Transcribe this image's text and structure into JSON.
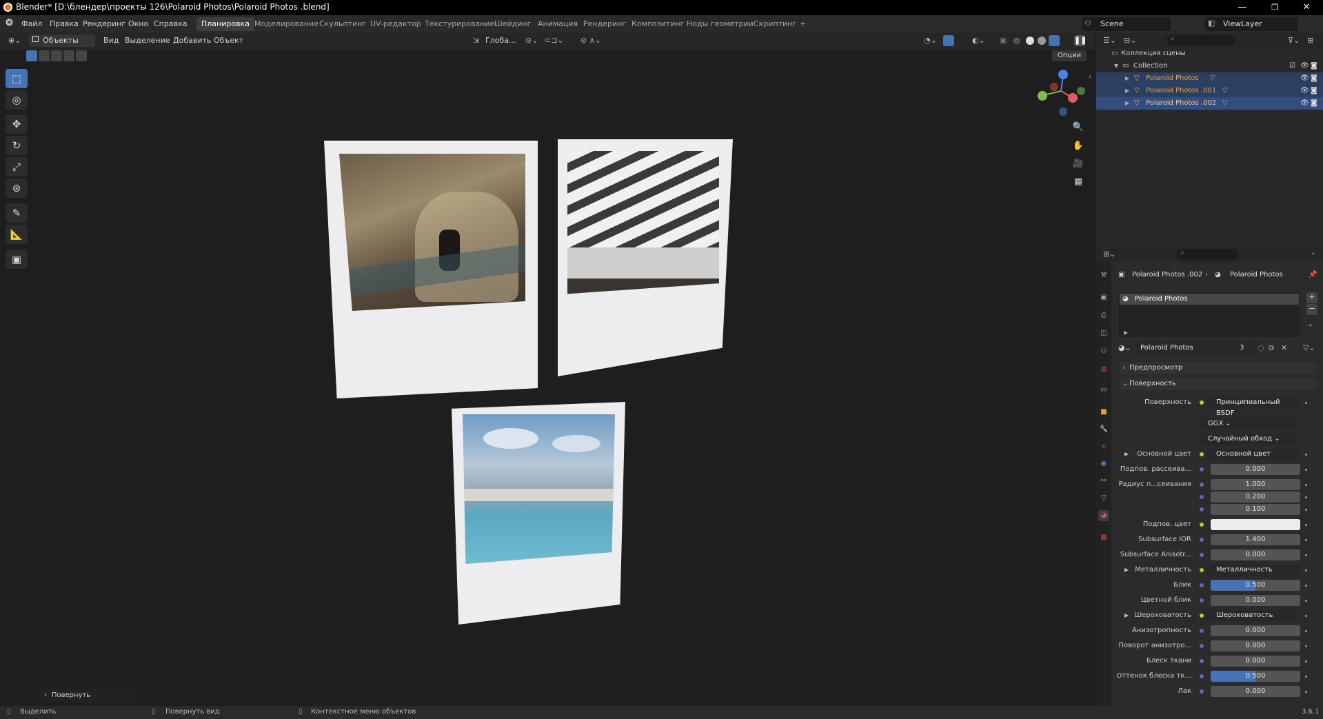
{
  "window": {
    "title": "Blender* [D:\\блендер\\проекты 126\\Polaroid Photos\\Polaroid Photos .blend]",
    "minimize": "—",
    "maximize": "❐",
    "close": "✕"
  },
  "menu": [
    "Файл",
    "Правка",
    "Рендеринг",
    "Окно",
    "Справка"
  ],
  "workspaces": [
    "Планировка",
    "Моделирование",
    "Скульптинг",
    "UV-редактор",
    "Текстурирование",
    "Шейдинг",
    "Анимация",
    "Рендеринг",
    "Композитинг",
    "Ноды геометрии",
    "Скриптинг",
    "+"
  ],
  "scene": {
    "name": "Scene",
    "view_layer": "ViewLayer"
  },
  "viewport_header": {
    "mode": "Объекты",
    "menus": [
      "Вид",
      "Выделение",
      "Добавить",
      "Объект"
    ],
    "transform": "Глоба...",
    "options": "Опции"
  },
  "redo_panel": "Повернуть",
  "outliner": {
    "root": "Коллекция сцены",
    "collection": "Collection",
    "objects": [
      "Polaroid Photos",
      "Polaroid Photos .001",
      "Polaroid Photos .002"
    ]
  },
  "properties": {
    "breadcrumb_object": "Polaroid Photos .002",
    "breadcrumb_material": "Polaroid Photos",
    "slot": "Polaroid Photos",
    "material_name": "Polaroid Photos",
    "users": "3",
    "sections": {
      "preview": "Предпросмотр",
      "surface": "Поверхность"
    },
    "rows": [
      {
        "label": "Поверхность",
        "value": "Принципиальный BSDF",
        "type": "link"
      },
      {
        "label": "",
        "value": "GGX ⌄",
        "type": "dropdown"
      },
      {
        "label": "",
        "value": "Случайный обход ⌄",
        "type": "dropdown"
      },
      {
        "label": "Основной цвет",
        "value": "Основной цвет",
        "type": "link"
      },
      {
        "label": "Подпов. рассеива...",
        "value": "0.000",
        "type": "num"
      },
      {
        "label": "Радиус п...сеивания",
        "value": "1.000",
        "type": "num"
      },
      {
        "label": "",
        "value": "0.200",
        "type": "num"
      },
      {
        "label": "",
        "value": "0.100",
        "type": "num"
      },
      {
        "label": "Подпов. цвет",
        "value": "",
        "type": "color"
      },
      {
        "label": "Subsurface IOR",
        "value": "1.400",
        "type": "num"
      },
      {
        "label": "Subsurface Anisotr...",
        "value": "0.000",
        "type": "num"
      },
      {
        "label": "Металличность",
        "value": "Металличность",
        "type": "link"
      },
      {
        "label": "Блик",
        "value": "0.500",
        "type": "slider"
      },
      {
        "label": "Цветной блик",
        "value": "0.000",
        "type": "num"
      },
      {
        "label": "Шероховатость",
        "value": "Шероховатость",
        "type": "link"
      },
      {
        "label": "Анизотропность",
        "value": "0.000",
        "type": "num"
      },
      {
        "label": "Поворот анизотро...",
        "value": "0.000",
        "type": "num"
      },
      {
        "label": "Блеск ткани",
        "value": "0.000",
        "type": "num"
      },
      {
        "label": "Оттенок блеска тк...",
        "value": "0.500",
        "type": "slider"
      },
      {
        "label": "Лак",
        "value": "0.000",
        "type": "num"
      }
    ]
  },
  "statusbar": {
    "select": "Выделить",
    "rotate": "Повернуть вид",
    "context": "Контекстное меню объектов",
    "version": "3.6.1"
  },
  "colors": {
    "accent": "#4772b3",
    "selected_row": "#334d80",
    "object_orange": "#e8a23a",
    "mesh_teal": "#3fc8c8"
  }
}
